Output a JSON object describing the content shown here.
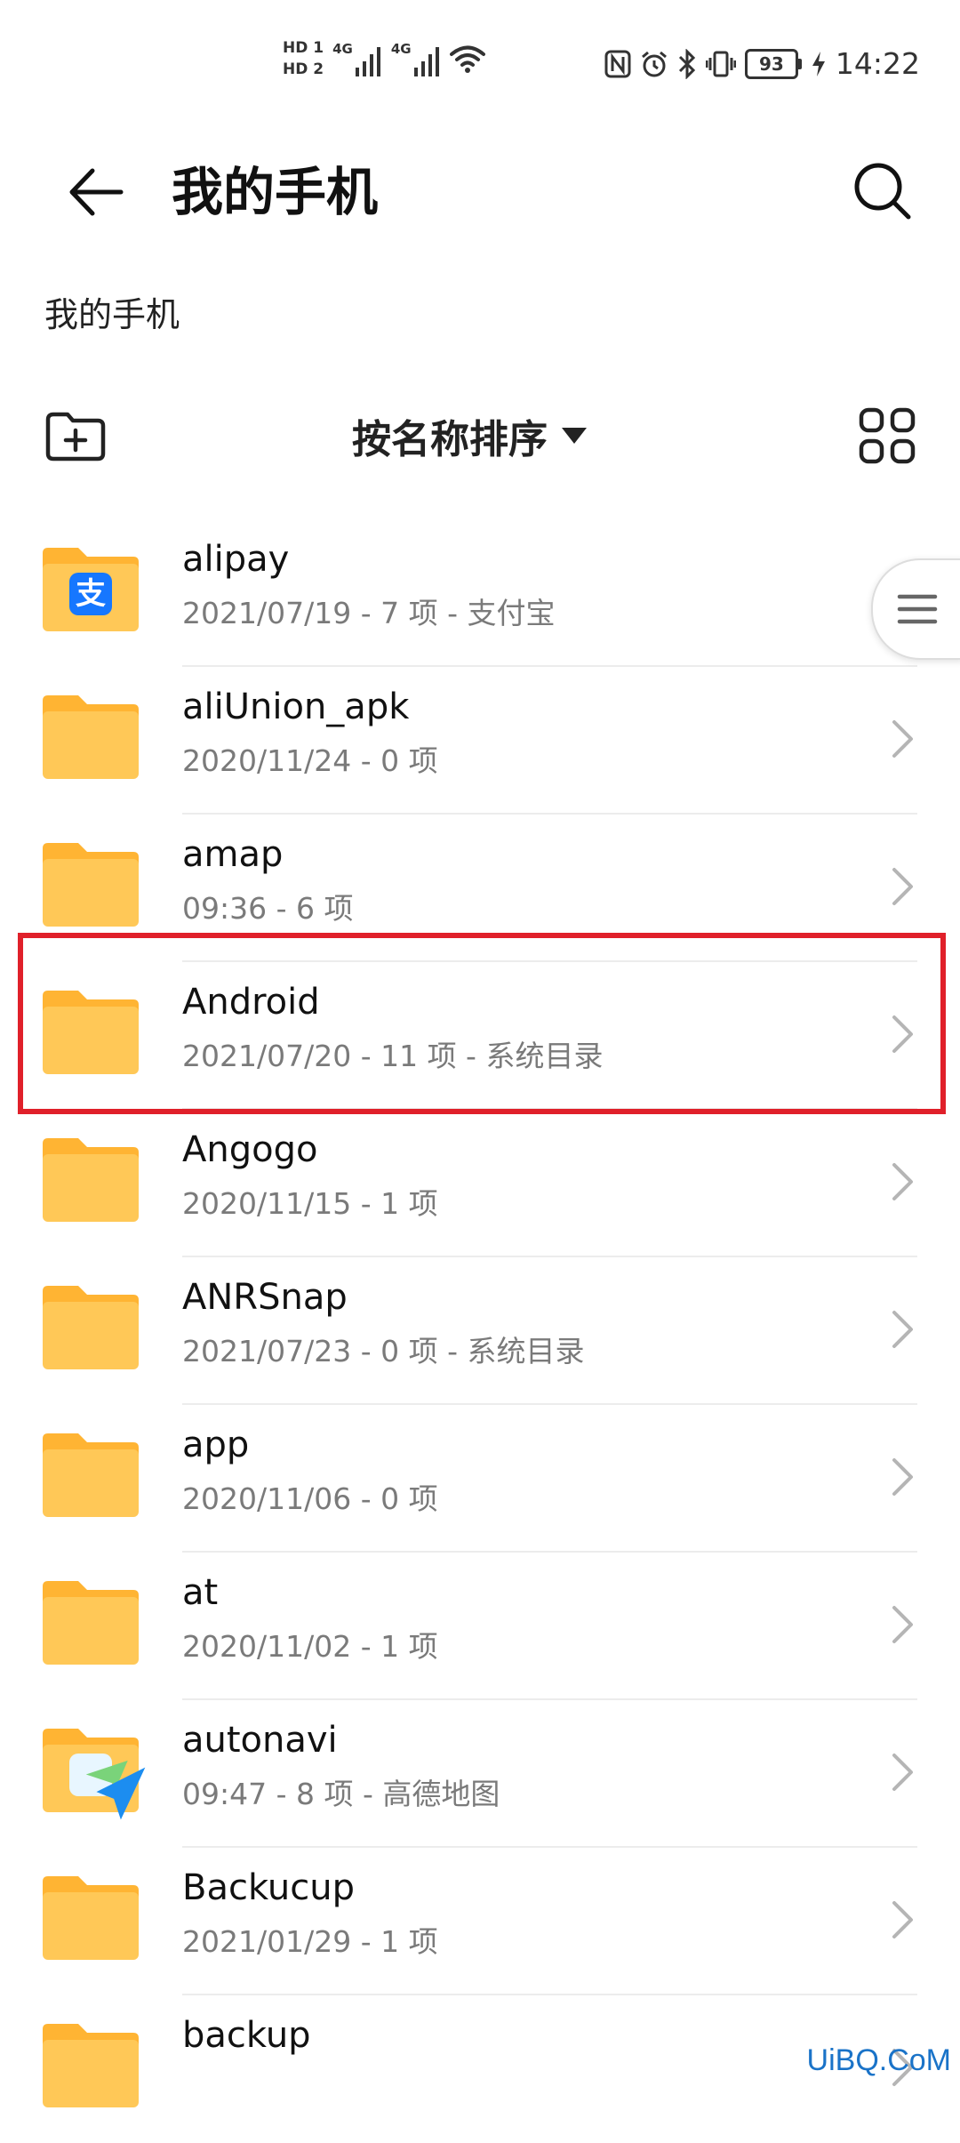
{
  "status_bar": {
    "hd1": "HD 1",
    "hd2": "HD 2",
    "net1": "4G",
    "net2": "4G",
    "battery": "93",
    "time": "14:22"
  },
  "header": {
    "title": "我的手机",
    "back_icon": "arrow-left-icon",
    "search_icon": "search-icon"
  },
  "breadcrumb": "我的手机",
  "toolbar": {
    "sort_label": "按名称排序",
    "new_folder_icon": "folder-plus-icon",
    "grid_view_icon": "grid-view-icon"
  },
  "files": [
    {
      "name": "alipay",
      "meta": "2021/07/19 - 7 项 - 支付宝",
      "badge": "支"
    },
    {
      "name": "aliUnion_apk",
      "meta": "2020/11/24 - 0 项"
    },
    {
      "name": "amap",
      "meta": "09:36 - 6 项"
    },
    {
      "name": "Android",
      "meta": "2021/07/20 - 11 项 - 系统目录"
    },
    {
      "name": "Angogo",
      "meta": "2020/11/15 - 1 项"
    },
    {
      "name": "ANRSnap",
      "meta": "2021/07/23 - 0 项 - 系统目录"
    },
    {
      "name": "app",
      "meta": "2020/11/06 - 0 项"
    },
    {
      "name": "at",
      "meta": "2020/11/02 - 1 项"
    },
    {
      "name": "autonavi",
      "meta": "09:47 - 8 项 - 高德地图"
    },
    {
      "name": "Backucup",
      "meta": "2021/01/29 - 1 项"
    },
    {
      "name": "backup",
      "meta": ""
    }
  ],
  "colors": {
    "folder": "#ffc857",
    "folder_tab": "#ffb433",
    "highlight": "#e0202a",
    "alipay": "#1677ff",
    "watermark": "#1a73c8"
  },
  "watermark": "UiBQ.CoM"
}
